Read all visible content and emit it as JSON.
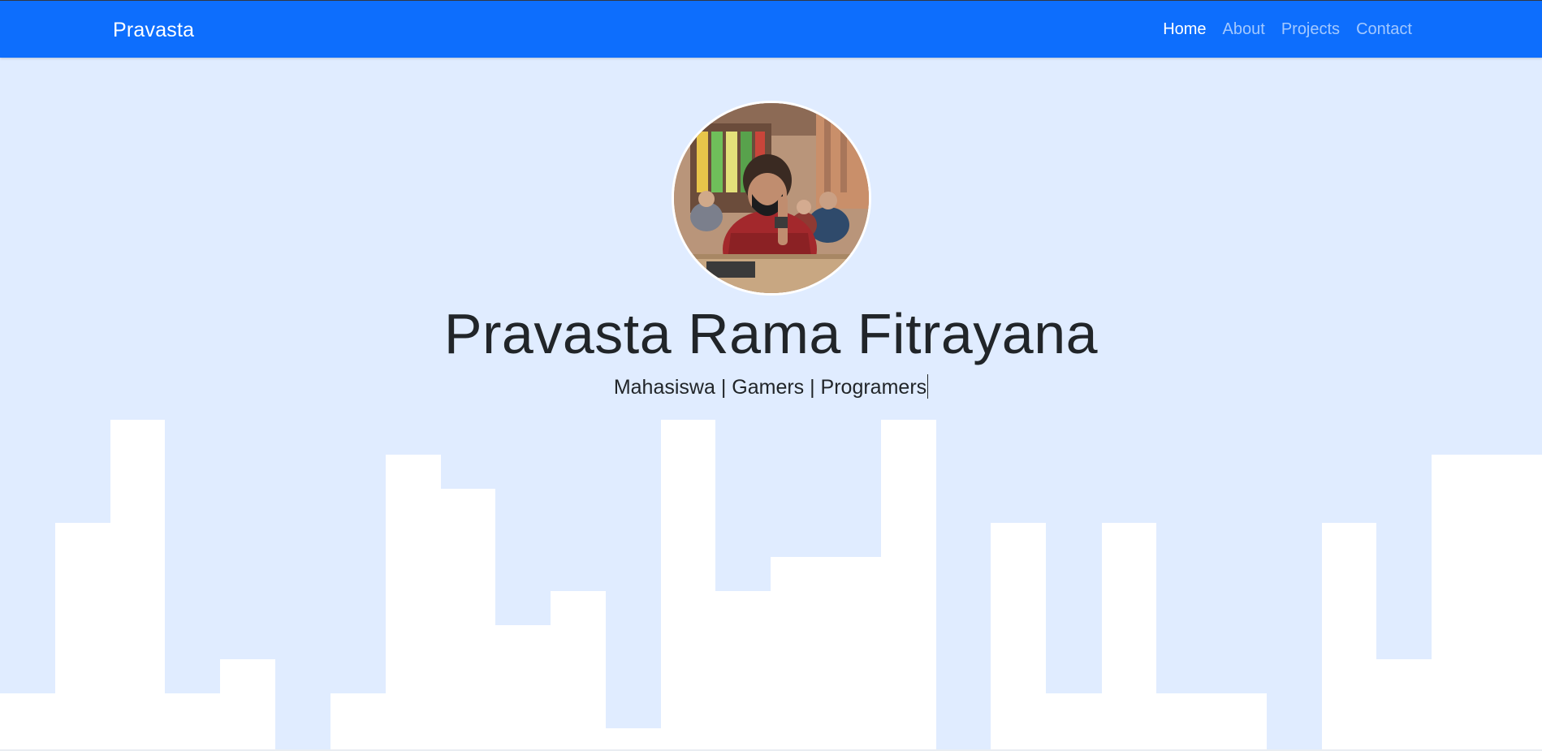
{
  "navbar": {
    "brand": "Pravasta",
    "links": [
      {
        "label": "Home",
        "active": true
      },
      {
        "label": "About",
        "active": false
      },
      {
        "label": "Projects",
        "active": false
      },
      {
        "label": "Contact",
        "active": false
      }
    ]
  },
  "hero": {
    "name": "Pravasta Rama Fitrayana",
    "subtitle": "Mahasiswa | Gamers | Programers",
    "avatar_alt": "profile-photo"
  },
  "colors": {
    "navbar": "#0d6efd",
    "hero_background": "#e0ecff",
    "skyline": "#ffffff",
    "text": "#212529"
  }
}
